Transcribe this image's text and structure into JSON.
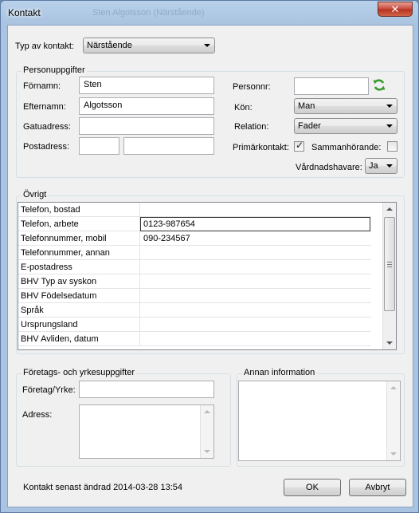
{
  "window": {
    "title": "Kontakt",
    "ghost_title": "Sten Algotsson (Närstående)",
    "close_glyph": "✕"
  },
  "top": {
    "type_label": "Typ av kontakt:",
    "type_value": "Närstående"
  },
  "person": {
    "group_title": "Personuppgifter",
    "first_name_label": "Förnamn:",
    "first_name_value": "Sten",
    "last_name_label": "Efternamn:",
    "last_name_value": "Algotsson",
    "street_label": "Gatuadress:",
    "street_value": "",
    "postal_label": "Postadress:",
    "postal_code_value": "",
    "postal_city_value": "",
    "personnr_label": "Personnr:",
    "personnr_value": "",
    "gender_label": "Kön:",
    "gender_value": "Man",
    "relation_label": "Relation:",
    "relation_value": "Fader",
    "primary_label": "Primärkontakt:",
    "primary_checked": true,
    "cohabiting_label": "Sammanhörande:",
    "cohabiting_checked": false,
    "guardian_label": "Vårdnadshavare:",
    "guardian_value": "Ja"
  },
  "other": {
    "group_title": "Övrigt",
    "rows": [
      {
        "key": "Telefon, bostad",
        "value": ""
      },
      {
        "key": "Telefon, arbete",
        "value": "0123-987654"
      },
      {
        "key": "Telefonnummer, mobil",
        "value": "090-234567"
      },
      {
        "key": "Telefonnummer, annan",
        "value": ""
      },
      {
        "key": "E-postadress",
        "value": ""
      },
      {
        "key": "BHV Typ av syskon",
        "value": ""
      },
      {
        "key": "BHV Födelsedatum",
        "value": ""
      },
      {
        "key": "Språk",
        "value": ""
      },
      {
        "key": "Ursprungsland",
        "value": ""
      },
      {
        "key": "BHV Avliden, datum",
        "value": ""
      }
    ]
  },
  "company": {
    "group_title": "Företags- och yrkesuppgifter",
    "company_label": "Företag/Yrke:",
    "company_value": "",
    "address_label": "Adress:",
    "address_value": ""
  },
  "notes": {
    "group_title": "Annan information",
    "value": ""
  },
  "footer": {
    "status": "Kontakt senast ändrad 2014-03-28 13:54",
    "ok_label": "OK",
    "cancel_label": "Avbryt"
  },
  "icons": {
    "refresh": "refresh-icon",
    "check": "✓",
    "accent": "#3a9a2e"
  }
}
